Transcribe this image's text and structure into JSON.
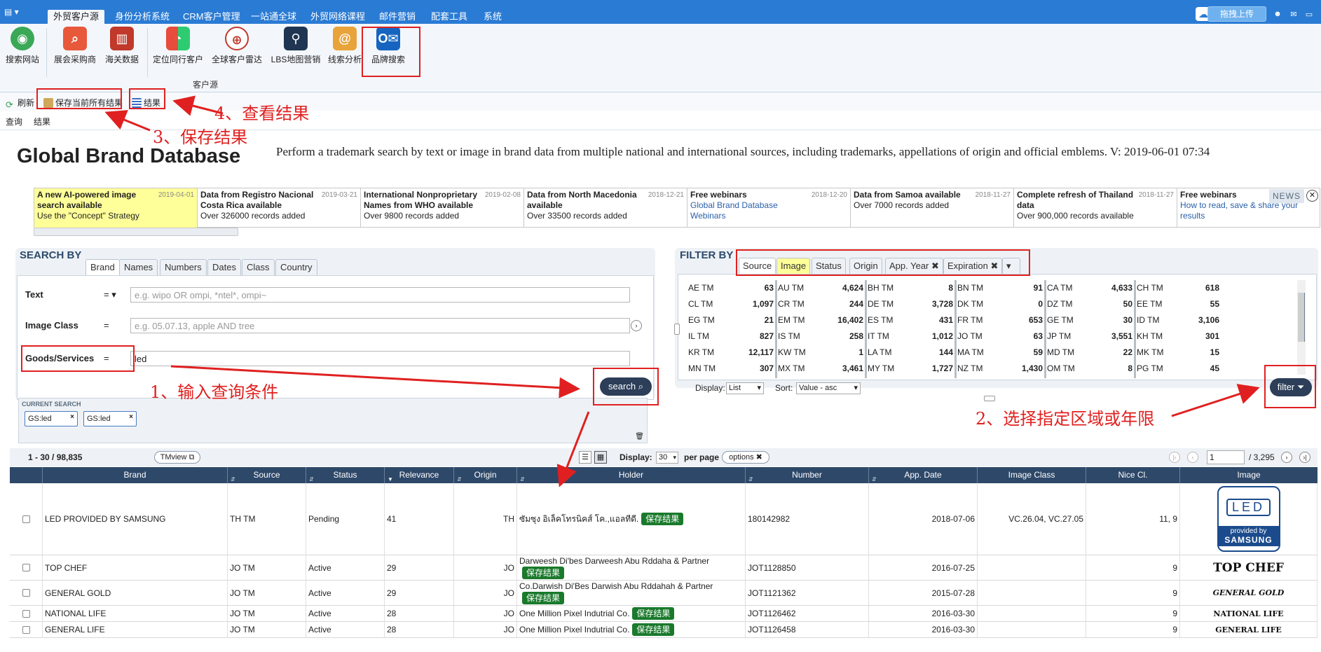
{
  "menubar": {
    "tabs": [
      "外贸客户源",
      "身份分析系统",
      "CRM客户管理",
      "一站通全球",
      "外贸网络课程",
      "邮件营销",
      "配套工具",
      "系统"
    ],
    "upload_label": "拖拽上传"
  },
  "ribbon": {
    "items": [
      "搜索网站",
      "展会采购商",
      "海关数据",
      "定位同行客户",
      "全球客户雷达",
      "LBS地图营销",
      "线索分析",
      "品牌搜索"
    ],
    "group_label": "客户源"
  },
  "toolbar": {
    "refresh": "刷新",
    "save_all": "保存当前所有结果",
    "results": "结果"
  },
  "subtabs": [
    "查询",
    "结果"
  ],
  "annotations": {
    "step1": "1、输入查询条件",
    "step2": "2、选择指定区域或年限",
    "step3": "3、保存结果",
    "step4": "4、查看结果"
  },
  "page": {
    "title": "Global Brand Database",
    "description": "Perform a trademark search by text or image in brand data from multiple national and international sources, including trademarks, appellations of origin and official emblems. V: 2019-06-01 07:34"
  },
  "news": {
    "badge": "NEWS",
    "items": [
      {
        "title": "A new AI-powered image search available",
        "date": "2019-04-01",
        "body": "Use the \"Concept\" Strategy",
        "link": ""
      },
      {
        "title": "Data from Registro Nacional Costa Rica available",
        "date": "2019-03-21",
        "body": "Over 326000 records added",
        "link": ""
      },
      {
        "title": "International Nonproprietary Names from WHO available",
        "date": "2019-02-08",
        "body": "Over 9800 records added",
        "link": ""
      },
      {
        "title": "Data from North Macedonia available",
        "date": "2018-12-21",
        "body": "Over 33500 records added",
        "link": ""
      },
      {
        "title": "Free webinars",
        "date": "2018-12-20",
        "body": "",
        "link": "Global Brand Database Webinars"
      },
      {
        "title": "Data from Samoa available",
        "date": "2018-11-27",
        "body": "Over 7000 records added",
        "link": ""
      },
      {
        "title": "Complete refresh of Thailand data",
        "date": "2018-11-27",
        "body": "Over 900,000 records available",
        "link": ""
      },
      {
        "title": "Free webinars",
        "date": "",
        "body": "",
        "link": "How to read, save & share your results"
      }
    ]
  },
  "search": {
    "heading": "SEARCH BY",
    "tabs": [
      "Brand",
      "Names",
      "Numbers",
      "Dates",
      "Class",
      "Country"
    ],
    "fields": [
      {
        "label": "Text",
        "op": "= ▾",
        "placeholder": "e.g. wipo OR ompi, *ntel*, ompi~",
        "value": ""
      },
      {
        "label": "Image Class",
        "op": "=",
        "placeholder": "e.g. 05.07.13, apple AND tree",
        "value": ""
      },
      {
        "label": "Goods/Services",
        "op": "=",
        "placeholder": "",
        "value": "led"
      }
    ],
    "search_button": "search",
    "current_label": "CURRENT SEARCH",
    "chips": [
      "GS:led",
      "GS:led"
    ]
  },
  "filter": {
    "heading": "FILTER BY",
    "tabs": [
      "Source",
      "Image",
      "Status",
      "Origin",
      "App. Year",
      "Expiration"
    ],
    "columns": [
      [
        [
          "AE TM",
          "63"
        ],
        [
          "CL TM",
          "1,097"
        ],
        [
          "EG TM",
          "21"
        ],
        [
          "IL TM",
          "827"
        ],
        [
          "KR TM",
          "12,117"
        ],
        [
          "MN TM",
          "307"
        ]
      ],
      [
        [
          "AU TM",
          "4,624"
        ],
        [
          "CR TM",
          "244"
        ],
        [
          "EM TM",
          "16,402"
        ],
        [
          "IS TM",
          "258"
        ],
        [
          "KW TM",
          "1"
        ],
        [
          "MX TM",
          "3,461"
        ]
      ],
      [
        [
          "BH TM",
          "8"
        ],
        [
          "DE TM",
          "3,728"
        ],
        [
          "ES TM",
          "431"
        ],
        [
          "IT TM",
          "1,012"
        ],
        [
          "LA TM",
          "144"
        ],
        [
          "MY TM",
          "1,727"
        ]
      ],
      [
        [
          "BN TM",
          "91"
        ],
        [
          "DK TM",
          "0"
        ],
        [
          "FR TM",
          "653"
        ],
        [
          "JO TM",
          "63"
        ],
        [
          "MA TM",
          "59"
        ],
        [
          "NZ TM",
          "1,430"
        ]
      ],
      [
        [
          "CA TM",
          "4,633"
        ],
        [
          "DZ TM",
          "50"
        ],
        [
          "GE TM",
          "30"
        ],
        [
          "JP TM",
          "3,551"
        ],
        [
          "MD TM",
          "22"
        ],
        [
          "OM TM",
          "8"
        ]
      ],
      [
        [
          "CH TM",
          "618"
        ],
        [
          "EE TM",
          "55"
        ],
        [
          "ID TM",
          "3,106"
        ],
        [
          "KH TM",
          "301"
        ],
        [
          "MK TM",
          "15"
        ],
        [
          "PG TM",
          "45"
        ]
      ]
    ],
    "display_label": "Display:",
    "display_value": "List",
    "sort_label": "Sort:",
    "sort_value": "Value - asc",
    "filter_button": "filter"
  },
  "results": {
    "range": "1 - 30 / 98,835",
    "tmview": "TMview",
    "display_label": "Display:",
    "per_page_value": "30",
    "per_page_label": "per page",
    "options": "options",
    "page_value": "1",
    "page_total": "/ 3,295",
    "columns": [
      "Brand",
      "Source",
      "Status",
      "Relevance",
      "Origin",
      "Holder",
      "Number",
      "App. Date",
      "Image Class",
      "Nice Cl.",
      "Image"
    ],
    "save_label": "保存结果",
    "rows": [
      {
        "brand": "LED PROVIDED BY SAMSUNG",
        "source": "TH TM",
        "status": "Pending",
        "relevance": "41",
        "origin": "TH",
        "holder": "ซัมซุง อิเล็คโทรนิคส์ โค.,แอลทีดี.",
        "number": "180142982",
        "date": "2018-07-06",
        "imgclass": "VC.26.04, VC.27.05",
        "nice": "11, 9",
        "image": "samsung"
      },
      {
        "brand": "TOP CHEF",
        "source": "JO TM",
        "status": "Active",
        "relevance": "29",
        "origin": "JO",
        "holder": "Darweesh Di'bes Darweesh Abu Rddaha & Partner",
        "number": "JOT1128850",
        "date": "2016-07-25",
        "imgclass": "",
        "nice": "9",
        "image": "TOP CHEF"
      },
      {
        "brand": "GENERAL GOLD",
        "source": "JO TM",
        "status": "Active",
        "relevance": "29",
        "origin": "JO",
        "holder": "Co.Darwish Di'Bes Darwish Abu Rddahah & Partner",
        "number": "JOT1121362",
        "date": "2015-07-28",
        "imgclass": "",
        "nice": "9",
        "image": "GENERAL GOLD"
      },
      {
        "brand": "NATIONAL LIFE",
        "source": "JO TM",
        "status": "Active",
        "relevance": "28",
        "origin": "JO",
        "holder": "One Million Pixel Indutrial Co.",
        "number": "JOT1126462",
        "date": "2016-03-30",
        "imgclass": "",
        "nice": "9",
        "image": "NATIONAL LIFE"
      },
      {
        "brand": "GENERAL LIFE",
        "source": "JO TM",
        "status": "Active",
        "relevance": "28",
        "origin": "JO",
        "holder": "One Million Pixel Indutrial Co.",
        "number": "JOT1126458",
        "date": "2016-03-30",
        "imgclass": "",
        "nice": "9",
        "image": "GENERAL LIFE"
      }
    ],
    "samsung_top": "LED",
    "samsung_small": "provided by",
    "samsung_brand": "SAMSUNG"
  },
  "colors": {
    "accent": "#2a7bd4",
    "annotation": "#e02020",
    "save_green": "#1a7a2c",
    "header": "#2e4869"
  }
}
